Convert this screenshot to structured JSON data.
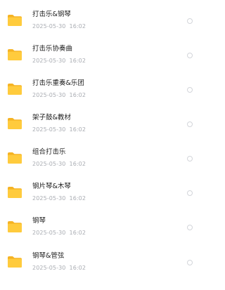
{
  "folder_list": {
    "items": [
      {
        "name": "打击乐&钢琴",
        "date": "2025-05-30",
        "time": "16:02",
        "icon": "folder-icon"
      },
      {
        "name": "打击乐协奏曲",
        "date": "2025-05-30",
        "time": "16:02",
        "icon": "folder-icon"
      },
      {
        "name": "打击乐重奏&乐团",
        "date": "2025-05-30",
        "time": "16:02",
        "icon": "folder-icon"
      },
      {
        "name": "架子鼓&教材",
        "date": "2025-05-30",
        "time": "16:02",
        "icon": "folder-icon"
      },
      {
        "name": "组合打击乐",
        "date": "2025-05-30",
        "time": "16:02",
        "icon": "folder-icon"
      },
      {
        "name": "钢片琴&木琴",
        "date": "2025-05-30",
        "time": "16:02",
        "icon": "folder-icon"
      },
      {
        "name": "钢琴",
        "date": "2025-05-30",
        "time": "16:02",
        "icon": "folder-icon"
      },
      {
        "name": "钢琴&管弦",
        "date": "2025-05-30",
        "time": "16:02",
        "icon": "folder-icon"
      }
    ]
  },
  "colors": {
    "folder_front": "#FFCB3D",
    "folder_back": "#F5B324",
    "name_text": "#1F1F1F",
    "meta_text": "#A9ACB2",
    "radio_border": "#D3D5DA"
  }
}
